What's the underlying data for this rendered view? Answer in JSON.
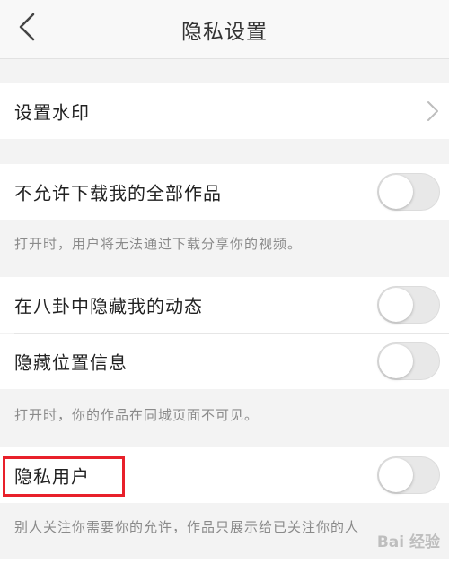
{
  "header": {
    "title": "隐私设置",
    "back_icon": "chevron-left-icon"
  },
  "settings": {
    "watermark": {
      "label": "设置水印",
      "icon": "chevron-right-icon"
    },
    "no_download": {
      "label": "不允许下载我的全部作品",
      "enabled": false
    },
    "no_download_hint": "打开时，用户将无法通过下载分享你的视频。",
    "hide_gossip": {
      "label": "在八卦中隐藏我的动态",
      "enabled": false
    },
    "hide_location": {
      "label": "隐藏位置信息",
      "enabled": false
    },
    "location_hint": "打开时，你的作品在同城页面不可见。",
    "private_user": {
      "label": "隐私用户",
      "enabled": false
    },
    "private_user_hint": "别人关注你需要你的允许，作品只展示给已关注你的人"
  },
  "overlay": {
    "highlight_color": "#e8202a",
    "watermark_text": "Bai 经验"
  }
}
